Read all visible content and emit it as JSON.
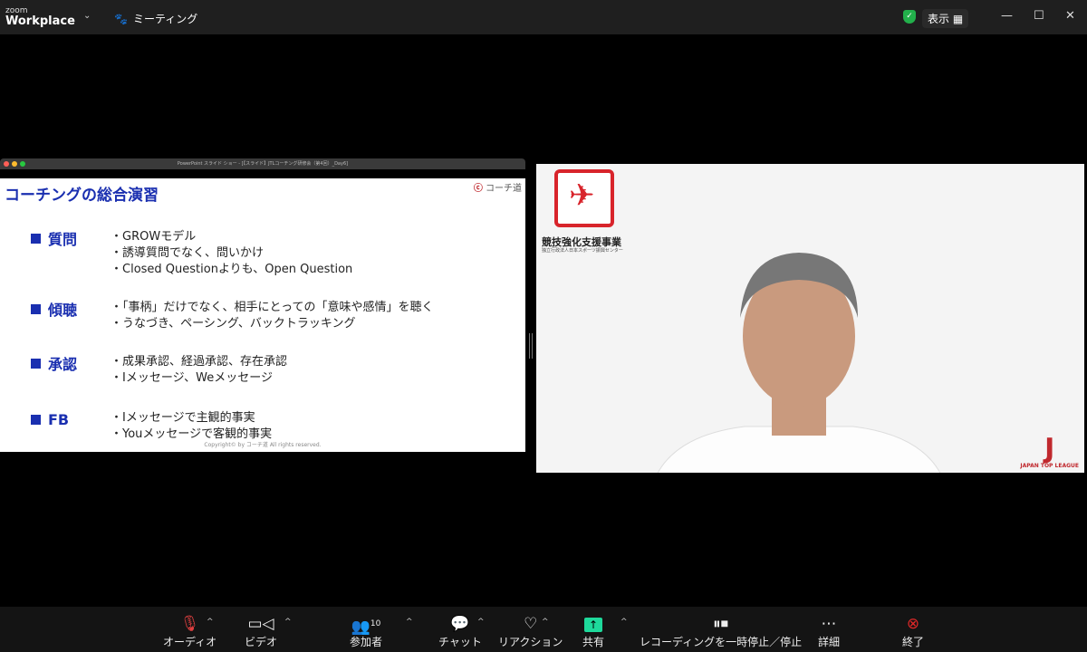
{
  "app": {
    "logo_top": "zoom",
    "logo_bottom": "Workplace",
    "meeting_label": "ミーティング",
    "view_label": "表示"
  },
  "share": {
    "window_title": "PowerPoint スライド ショー - [【スライド】JTLコーチング研修会（第4回）_Day6]",
    "slide_title": "コーチングの総合演習",
    "brand": "コーチ道",
    "sections": [
      {
        "heading": "質問",
        "items": [
          "・GROWモデル",
          "・誘導質問でなく、問いかけ",
          "・Closed Questionよりも、Open Question"
        ]
      },
      {
        "heading": "傾聴",
        "items": [
          "・「事柄」だけでなく、相手にとっての「意味や感情」を聴く",
          "・うなづき、ペーシング、バックトラッキング"
        ]
      },
      {
        "heading": "承認",
        "items": [
          "・成果承認、経過承認、存在承認",
          "・Iメッセージ、Weメッセージ"
        ]
      },
      {
        "heading": "FB",
        "items": [
          "・Iメッセージで主観的事実",
          "・Youメッセージで客観的事実"
        ]
      }
    ],
    "copyright": "Copyright© by コーチ道 All rights reserved."
  },
  "camera": {
    "org_title": "競技強化支援事業",
    "org_sub": "独立行政法人日本スポーツ振興センター",
    "league": "JAPAN TOP LEAGUE"
  },
  "toolbar": {
    "audio": "オーディオ",
    "video": "ビデオ",
    "participants": "参加者",
    "participant_count": "10",
    "chat": "チャット",
    "reactions": "リアクション",
    "share": "共有",
    "recording": "レコーディングを一時停止／停止",
    "more": "詳細",
    "end": "終了"
  },
  "colors": {
    "accent": "#1a2fb0",
    "share_green": "#1ed99b",
    "end_red": "#e02828"
  }
}
